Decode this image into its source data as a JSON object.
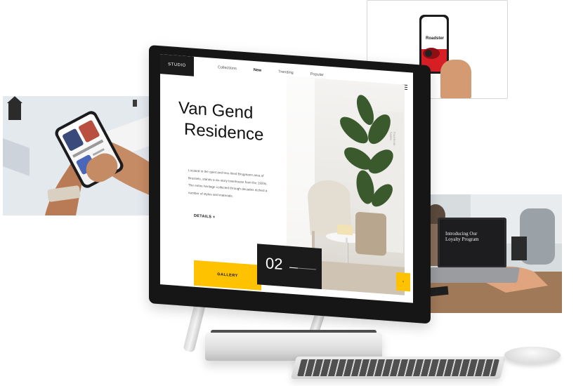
{
  "left_card": {},
  "right_top_card": {
    "phone_title": "Roadster"
  },
  "right_mid_card": {
    "laptop_title": "Introducing Our Loyalty Program"
  },
  "site": {
    "brand": "STUDIO",
    "nav": [
      {
        "label": "Collections",
        "active": false
      },
      {
        "label": "New",
        "active": true
      },
      {
        "label": "Trending",
        "active": false
      },
      {
        "label": "Popular",
        "active": false
      }
    ],
    "hero_title_line1": "Van Gend",
    "hero_title_line2": "Residence",
    "hero_description": "Located in the quiet and tree-lined Brugmann area of Brussels, stands a six-story townhouse from the 1920s. The entire heritage collected through decades etched a number of styles and materials.",
    "details_label": "DETAILS +",
    "side_label": "Facebook · Twitter",
    "gallery_label": "GALLERY",
    "counter": "02",
    "prev_arrow": "‹",
    "next_arrow": "›"
  },
  "colors": {
    "accent": "#ffc200",
    "dark": "#1b1b1b"
  }
}
